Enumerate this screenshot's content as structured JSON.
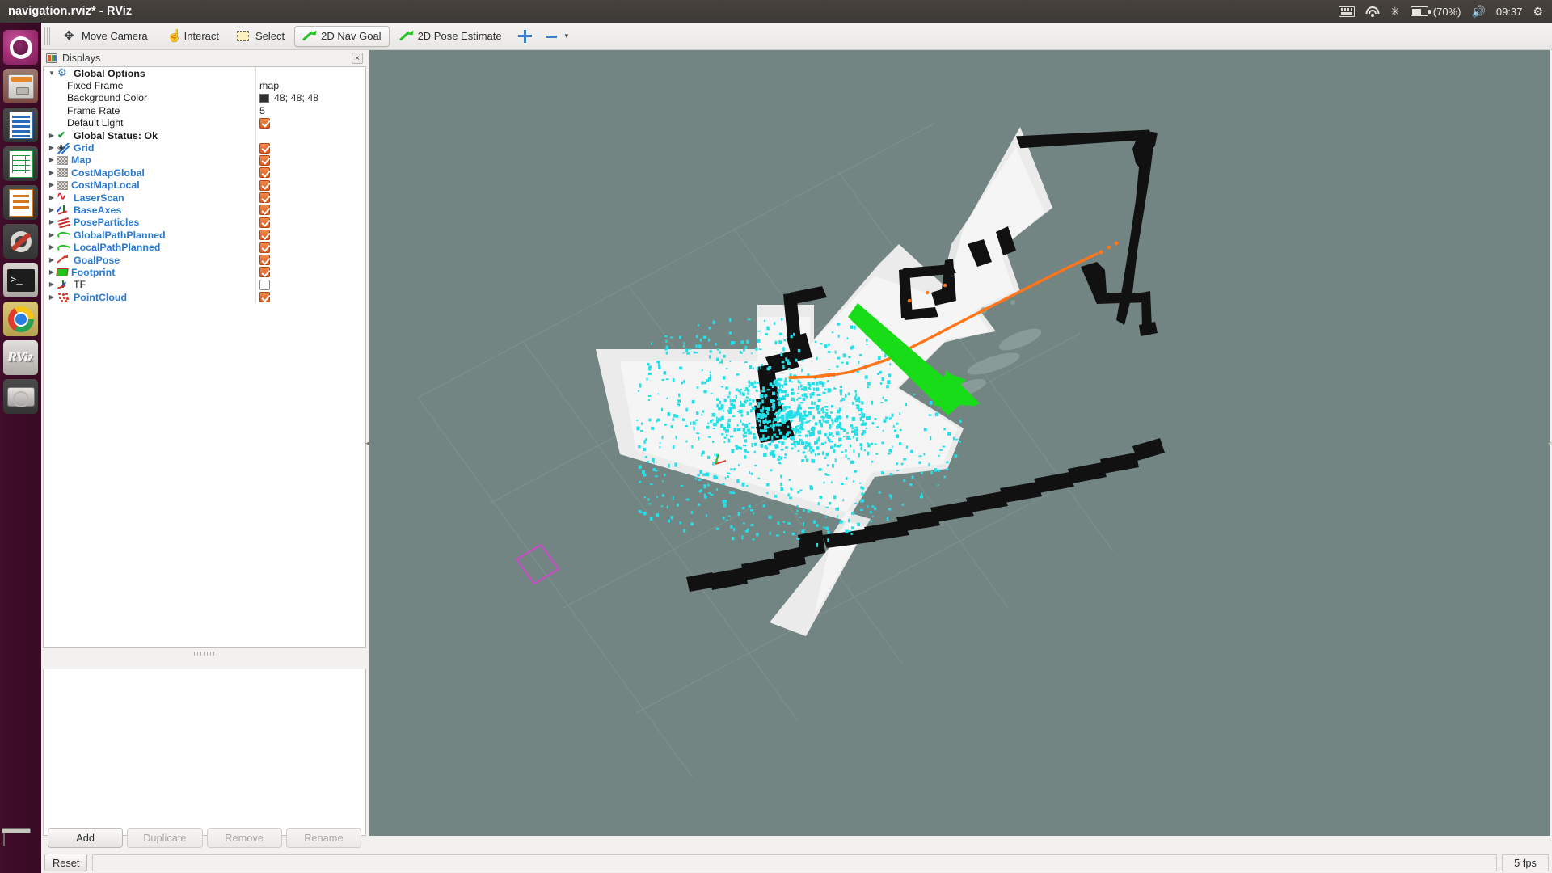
{
  "window": {
    "title": "navigation.rviz* - RViz"
  },
  "tray": {
    "keyboard_icon": "keyboard-icon",
    "wifi_icon": "wifi-icon",
    "bluetooth_glyph": "✳",
    "battery_label": "(70%)",
    "volume_glyph": "🔊",
    "clock": "09:37",
    "gear_glyph": "⚙"
  },
  "launcher": {
    "items": [
      {
        "name": "ubuntu-dash",
        "label": "Ubuntu Dash",
        "running": false
      },
      {
        "name": "files",
        "label": "Files",
        "running": true
      },
      {
        "name": "libreoffice-writer",
        "label": "LibreOffice Writer",
        "running": false
      },
      {
        "name": "libreoffice-calc",
        "label": "LibreOffice Calc",
        "running": false
      },
      {
        "name": "libreoffice-impress",
        "label": "LibreOffice Impress",
        "running": false
      },
      {
        "name": "system-settings",
        "label": "System Settings",
        "running": false
      },
      {
        "name": "terminal",
        "label": "Terminal",
        "running": true
      },
      {
        "name": "google-chrome",
        "label": "Google Chrome",
        "running": true
      },
      {
        "name": "rviz",
        "label": "RViz",
        "running": true
      },
      {
        "name": "disk-usage",
        "label": "Disk Usage Analyzer",
        "running": false
      }
    ],
    "trash_label": "Trash"
  },
  "toolbar": {
    "buttons": [
      {
        "name": "move-camera",
        "label": "Move Camera",
        "icon": "move-camera-icon",
        "active": false
      },
      {
        "name": "interact",
        "label": "Interact",
        "icon": "hand-icon",
        "active": false
      },
      {
        "name": "select",
        "label": "Select",
        "icon": "select-rect-icon",
        "active": false
      },
      {
        "name": "2d-nav-goal",
        "label": "2D Nav Goal",
        "icon": "green-arrow-icon",
        "active": true
      },
      {
        "name": "2d-pose-estimate",
        "label": "2D Pose Estimate",
        "icon": "green-arrow-icon",
        "active": false
      },
      {
        "name": "publish-point",
        "label": "",
        "icon": "plus-crosshair-icon",
        "active": false
      },
      {
        "name": "measure",
        "label": "",
        "icon": "minus-icon",
        "active": false
      }
    ],
    "caret": "▾"
  },
  "displays": {
    "panel_title": "Displays",
    "close_label": "×",
    "tree": [
      {
        "name": "global-options",
        "label": "Global Options",
        "style": "bold",
        "icon": "gear-icon",
        "twisty": "▼",
        "indent": false,
        "value_type": "none",
        "value": ""
      },
      {
        "name": "fixed-frame",
        "label": "Fixed Frame",
        "style": "plain",
        "icon": "none",
        "twisty": "",
        "indent": true,
        "value_type": "text",
        "value": "map"
      },
      {
        "name": "background-color",
        "label": "Background Color",
        "style": "plain",
        "icon": "none",
        "twisty": "",
        "indent": true,
        "value_type": "color",
        "value": "48; 48; 48"
      },
      {
        "name": "frame-rate",
        "label": "Frame Rate",
        "style": "plain",
        "icon": "none",
        "twisty": "",
        "indent": true,
        "value_type": "text",
        "value": "5"
      },
      {
        "name": "default-light",
        "label": "Default Light",
        "style": "plain",
        "icon": "none",
        "twisty": "",
        "indent": true,
        "value_type": "checkbox",
        "value": "checked"
      },
      {
        "name": "global-status",
        "label": "Global Status: Ok",
        "style": "bold",
        "icon": "check-icon",
        "twisty": "▶",
        "indent": false,
        "value_type": "none",
        "value": ""
      },
      {
        "name": "grid",
        "label": "Grid",
        "style": "link",
        "icon": "grid-icon",
        "twisty": "▶",
        "indent": false,
        "value_type": "checkbox",
        "value": "checked"
      },
      {
        "name": "map",
        "label": "Map",
        "style": "link",
        "icon": "map-icon",
        "twisty": "▶",
        "indent": false,
        "value_type": "checkbox",
        "value": "checked"
      },
      {
        "name": "costmap-global",
        "label": "CostMapGlobal",
        "style": "link",
        "icon": "map-icon",
        "twisty": "▶",
        "indent": false,
        "value_type": "checkbox",
        "value": "checked"
      },
      {
        "name": "costmap-local",
        "label": "CostMapLocal",
        "style": "link",
        "icon": "map-icon",
        "twisty": "▶",
        "indent": false,
        "value_type": "checkbox",
        "value": "checked"
      },
      {
        "name": "laser-scan",
        "label": "LaserScan",
        "style": "link",
        "icon": "laserscan-icon",
        "twisty": "▶",
        "indent": false,
        "value_type": "checkbox",
        "value": "checked"
      },
      {
        "name": "base-axes",
        "label": "BaseAxes",
        "style": "link",
        "icon": "axes-icon",
        "twisty": "▶",
        "indent": false,
        "value_type": "checkbox",
        "value": "checked"
      },
      {
        "name": "pose-particles",
        "label": "PoseParticles",
        "style": "link",
        "icon": "pose-array-icon",
        "twisty": "▶",
        "indent": false,
        "value_type": "checkbox",
        "value": "checked"
      },
      {
        "name": "global-path-planned",
        "label": "GlobalPathPlanned",
        "style": "link",
        "icon": "path-icon",
        "twisty": "▶",
        "indent": false,
        "value_type": "checkbox",
        "value": "checked"
      },
      {
        "name": "local-path-planned",
        "label": "LocalPathPlanned",
        "style": "link",
        "icon": "path-icon",
        "twisty": "▶",
        "indent": false,
        "value_type": "checkbox",
        "value": "checked"
      },
      {
        "name": "goal-pose",
        "label": "GoalPose",
        "style": "link",
        "icon": "pose-arrow-icon",
        "twisty": "▶",
        "indent": false,
        "value_type": "checkbox",
        "value": "checked"
      },
      {
        "name": "footprint",
        "label": "Footprint",
        "style": "link",
        "icon": "polygon-icon",
        "twisty": "▶",
        "indent": false,
        "value_type": "checkbox",
        "value": "checked"
      },
      {
        "name": "tf",
        "label": "TF",
        "style": "plain",
        "icon": "tf-axes-icon",
        "twisty": "▶",
        "indent": false,
        "value_type": "checkbox",
        "value": "unchecked"
      },
      {
        "name": "point-cloud",
        "label": "PointCloud",
        "style": "link",
        "icon": "pointcloud-icon",
        "twisty": "▶",
        "indent": false,
        "value_type": "checkbox",
        "value": "checked"
      }
    ],
    "buttons": [
      {
        "name": "add-button",
        "label": "Add",
        "enabled": true
      },
      {
        "name": "duplicate-button",
        "label": "Duplicate",
        "enabled": false
      },
      {
        "name": "remove-button",
        "label": "Remove",
        "enabled": false
      },
      {
        "name": "rename-button",
        "label": "Rename",
        "enabled": false
      }
    ]
  },
  "statusbar": {
    "reset_label": "Reset",
    "message": "",
    "fps": "5 fps"
  },
  "view3d": {
    "background_color": "#72858 3",
    "map_free_color": "#ebebeb",
    "map_occupied_color": "#121212",
    "laser_color": "#22d9e0",
    "global_path_color": "#ff7b1e",
    "goal_arrow_color": "#16d916",
    "footprint_color": "#c04ac0"
  }
}
